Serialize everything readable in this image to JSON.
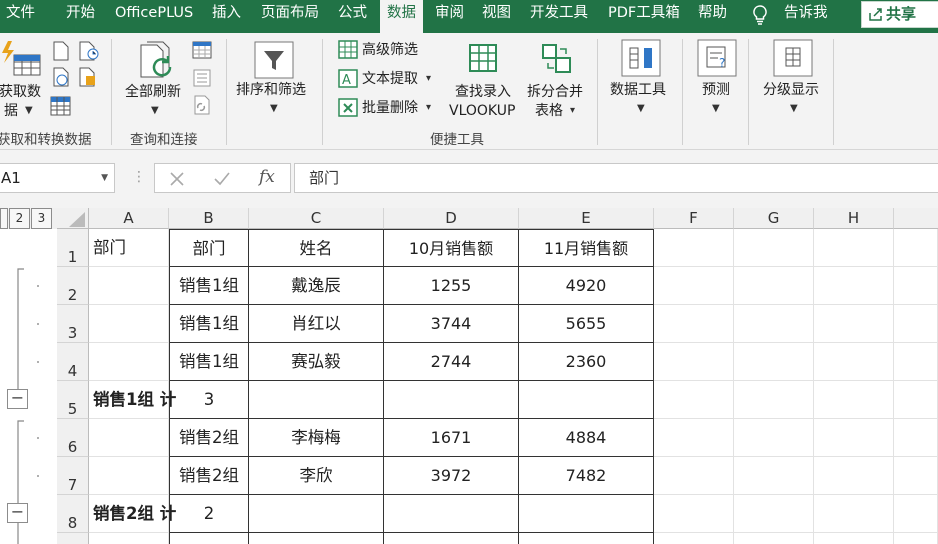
{
  "menu": {
    "items": [
      "文件",
      "开始",
      "OfficePLUS",
      "插入",
      "页面布局",
      "公式",
      "数据",
      "审阅",
      "视图",
      "开发工具",
      "PDF工具箱",
      "帮助"
    ],
    "tell_me": "告诉我",
    "share": "共享",
    "active": "数据"
  },
  "ribbon": {
    "get_data_line1": "获取数",
    "get_data_line2": "据",
    "refresh_all": "全部刷新",
    "sort_filter": "排序和筛选",
    "advanced_filter": "高级筛选",
    "text_extract": "文本提取",
    "batch_delete": "批量删除",
    "lookup_line1": "查找录入",
    "lookup_line2": "VLOOKUP",
    "split_line1": "拆分合并",
    "split_line2": "表格",
    "data_tools": "数据工具",
    "forecast": "预测",
    "outline": "分级显示",
    "groups": {
      "get_transform": "获取和转换数据",
      "queries": "查询和连接",
      "quick_tools": "便捷工具"
    }
  },
  "formula_bar": {
    "name_box": "A1",
    "formula": "部门"
  },
  "sheet": {
    "outline_levels": [
      "1",
      "2",
      "3"
    ],
    "columns": [
      "A",
      "B",
      "C",
      "D",
      "E",
      "F",
      "G",
      "H"
    ],
    "rows": [
      {
        "num": "1",
        "a": "部门",
        "b": "部门",
        "c": "姓名",
        "d": "10月销售额",
        "e": "11月销售额"
      },
      {
        "num": "2",
        "a": "",
        "b": "销售1组",
        "c": "戴逸辰",
        "d": "1255",
        "e": "4920"
      },
      {
        "num": "3",
        "a": "",
        "b": "销售1组",
        "c": "肖红以",
        "d": "3744",
        "e": "5655"
      },
      {
        "num": "4",
        "a": "",
        "b": "销售1组",
        "c": "赛弘毅",
        "d": "2744",
        "e": "2360"
      },
      {
        "num": "5",
        "a": "销售1组 计",
        "b": "3",
        "c": "",
        "d": "",
        "e": ""
      },
      {
        "num": "6",
        "a": "",
        "b": "销售2组",
        "c": "李梅梅",
        "d": "1671",
        "e": "4884"
      },
      {
        "num": "7",
        "a": "",
        "b": "销售2组",
        "c": "李欣",
        "d": "3972",
        "e": "7482"
      },
      {
        "num": "8",
        "a": "销售2组 计",
        "b": "2",
        "c": "",
        "d": "",
        "e": ""
      }
    ],
    "collapse_symbol": "−"
  }
}
